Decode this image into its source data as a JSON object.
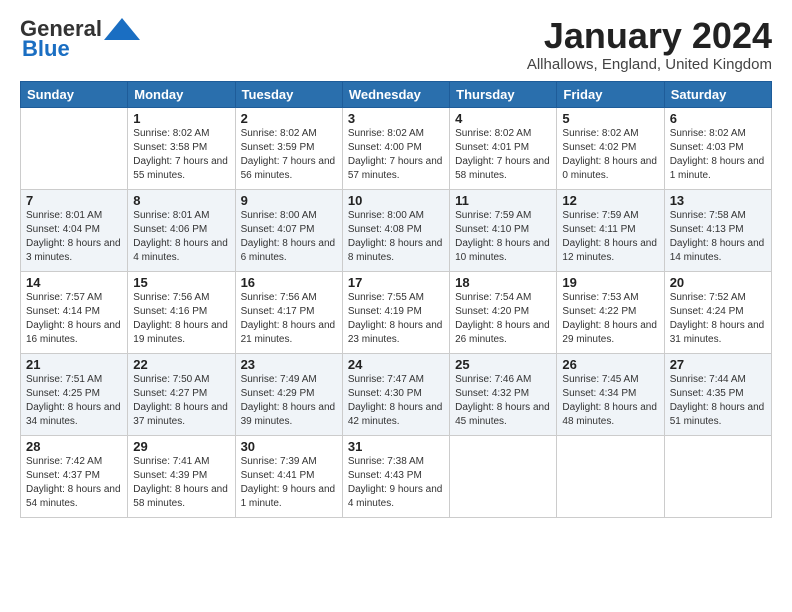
{
  "header": {
    "logo_line1": "General",
    "logo_line2": "Blue",
    "title": "January 2024",
    "location": "Allhallows, England, United Kingdom"
  },
  "columns": [
    "Sunday",
    "Monday",
    "Tuesday",
    "Wednesday",
    "Thursday",
    "Friday",
    "Saturday"
  ],
  "weeks": [
    [
      {
        "day": "",
        "sunrise": "",
        "sunset": "",
        "daylight": ""
      },
      {
        "day": "1",
        "sunrise": "Sunrise: 8:02 AM",
        "sunset": "Sunset: 3:58 PM",
        "daylight": "Daylight: 7 hours and 55 minutes."
      },
      {
        "day": "2",
        "sunrise": "Sunrise: 8:02 AM",
        "sunset": "Sunset: 3:59 PM",
        "daylight": "Daylight: 7 hours and 56 minutes."
      },
      {
        "day": "3",
        "sunrise": "Sunrise: 8:02 AM",
        "sunset": "Sunset: 4:00 PM",
        "daylight": "Daylight: 7 hours and 57 minutes."
      },
      {
        "day": "4",
        "sunrise": "Sunrise: 8:02 AM",
        "sunset": "Sunset: 4:01 PM",
        "daylight": "Daylight: 7 hours and 58 minutes."
      },
      {
        "day": "5",
        "sunrise": "Sunrise: 8:02 AM",
        "sunset": "Sunset: 4:02 PM",
        "daylight": "Daylight: 8 hours and 0 minutes."
      },
      {
        "day": "6",
        "sunrise": "Sunrise: 8:02 AM",
        "sunset": "Sunset: 4:03 PM",
        "daylight": "Daylight: 8 hours and 1 minute."
      }
    ],
    [
      {
        "day": "7",
        "sunrise": "Sunrise: 8:01 AM",
        "sunset": "Sunset: 4:04 PM",
        "daylight": "Daylight: 8 hours and 3 minutes."
      },
      {
        "day": "8",
        "sunrise": "Sunrise: 8:01 AM",
        "sunset": "Sunset: 4:06 PM",
        "daylight": "Daylight: 8 hours and 4 minutes."
      },
      {
        "day": "9",
        "sunrise": "Sunrise: 8:00 AM",
        "sunset": "Sunset: 4:07 PM",
        "daylight": "Daylight: 8 hours and 6 minutes."
      },
      {
        "day": "10",
        "sunrise": "Sunrise: 8:00 AM",
        "sunset": "Sunset: 4:08 PM",
        "daylight": "Daylight: 8 hours and 8 minutes."
      },
      {
        "day": "11",
        "sunrise": "Sunrise: 7:59 AM",
        "sunset": "Sunset: 4:10 PM",
        "daylight": "Daylight: 8 hours and 10 minutes."
      },
      {
        "day": "12",
        "sunrise": "Sunrise: 7:59 AM",
        "sunset": "Sunset: 4:11 PM",
        "daylight": "Daylight: 8 hours and 12 minutes."
      },
      {
        "day": "13",
        "sunrise": "Sunrise: 7:58 AM",
        "sunset": "Sunset: 4:13 PM",
        "daylight": "Daylight: 8 hours and 14 minutes."
      }
    ],
    [
      {
        "day": "14",
        "sunrise": "Sunrise: 7:57 AM",
        "sunset": "Sunset: 4:14 PM",
        "daylight": "Daylight: 8 hours and 16 minutes."
      },
      {
        "day": "15",
        "sunrise": "Sunrise: 7:56 AM",
        "sunset": "Sunset: 4:16 PM",
        "daylight": "Daylight: 8 hours and 19 minutes."
      },
      {
        "day": "16",
        "sunrise": "Sunrise: 7:56 AM",
        "sunset": "Sunset: 4:17 PM",
        "daylight": "Daylight: 8 hours and 21 minutes."
      },
      {
        "day": "17",
        "sunrise": "Sunrise: 7:55 AM",
        "sunset": "Sunset: 4:19 PM",
        "daylight": "Daylight: 8 hours and 23 minutes."
      },
      {
        "day": "18",
        "sunrise": "Sunrise: 7:54 AM",
        "sunset": "Sunset: 4:20 PM",
        "daylight": "Daylight: 8 hours and 26 minutes."
      },
      {
        "day": "19",
        "sunrise": "Sunrise: 7:53 AM",
        "sunset": "Sunset: 4:22 PM",
        "daylight": "Daylight: 8 hours and 29 minutes."
      },
      {
        "day": "20",
        "sunrise": "Sunrise: 7:52 AM",
        "sunset": "Sunset: 4:24 PM",
        "daylight": "Daylight: 8 hours and 31 minutes."
      }
    ],
    [
      {
        "day": "21",
        "sunrise": "Sunrise: 7:51 AM",
        "sunset": "Sunset: 4:25 PM",
        "daylight": "Daylight: 8 hours and 34 minutes."
      },
      {
        "day": "22",
        "sunrise": "Sunrise: 7:50 AM",
        "sunset": "Sunset: 4:27 PM",
        "daylight": "Daylight: 8 hours and 37 minutes."
      },
      {
        "day": "23",
        "sunrise": "Sunrise: 7:49 AM",
        "sunset": "Sunset: 4:29 PM",
        "daylight": "Daylight: 8 hours and 39 minutes."
      },
      {
        "day": "24",
        "sunrise": "Sunrise: 7:47 AM",
        "sunset": "Sunset: 4:30 PM",
        "daylight": "Daylight: 8 hours and 42 minutes."
      },
      {
        "day": "25",
        "sunrise": "Sunrise: 7:46 AM",
        "sunset": "Sunset: 4:32 PM",
        "daylight": "Daylight: 8 hours and 45 minutes."
      },
      {
        "day": "26",
        "sunrise": "Sunrise: 7:45 AM",
        "sunset": "Sunset: 4:34 PM",
        "daylight": "Daylight: 8 hours and 48 minutes."
      },
      {
        "day": "27",
        "sunrise": "Sunrise: 7:44 AM",
        "sunset": "Sunset: 4:35 PM",
        "daylight": "Daylight: 8 hours and 51 minutes."
      }
    ],
    [
      {
        "day": "28",
        "sunrise": "Sunrise: 7:42 AM",
        "sunset": "Sunset: 4:37 PM",
        "daylight": "Daylight: 8 hours and 54 minutes."
      },
      {
        "day": "29",
        "sunrise": "Sunrise: 7:41 AM",
        "sunset": "Sunset: 4:39 PM",
        "daylight": "Daylight: 8 hours and 58 minutes."
      },
      {
        "day": "30",
        "sunrise": "Sunrise: 7:39 AM",
        "sunset": "Sunset: 4:41 PM",
        "daylight": "Daylight: 9 hours and 1 minute."
      },
      {
        "day": "31",
        "sunrise": "Sunrise: 7:38 AM",
        "sunset": "Sunset: 4:43 PM",
        "daylight": "Daylight: 9 hours and 4 minutes."
      },
      {
        "day": "",
        "sunrise": "",
        "sunset": "",
        "daylight": ""
      },
      {
        "day": "",
        "sunrise": "",
        "sunset": "",
        "daylight": ""
      },
      {
        "day": "",
        "sunrise": "",
        "sunset": "",
        "daylight": ""
      }
    ]
  ]
}
